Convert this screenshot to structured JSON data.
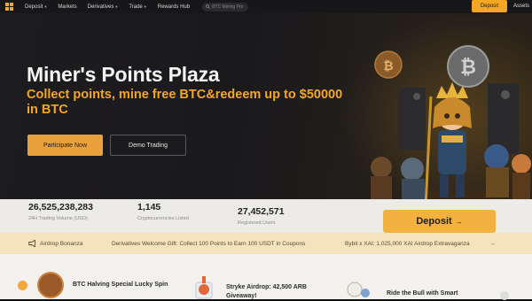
{
  "topbar": {
    "nav": [
      {
        "label": "Deposit",
        "caret": true
      },
      {
        "label": "Markets",
        "caret": false
      },
      {
        "label": "Derivatives",
        "caret": true
      },
      {
        "label": "Trade",
        "caret": true
      },
      {
        "label": "Rewards Hub",
        "caret": false
      }
    ],
    "search_placeholder": "BTC Mining Pro",
    "deposit_label": "Deposit",
    "assets_label": "Assets"
  },
  "hero": {
    "title": "Miner's Points Plaza",
    "subtitle": "Collect points, mine free BTC&redeem up to $50000 in BTC",
    "primary_button": "Participate Now",
    "secondary_button": "Demo Trading"
  },
  "stats": {
    "items": [
      {
        "value": "26,525,238,283",
        "label": "24H Trading Volume (USD)"
      },
      {
        "value": "1,145",
        "label": "Cryptocurrencies Listed"
      },
      {
        "value": "27,452,571",
        "label": "Registered Users"
      }
    ],
    "deposit_button": "Deposit",
    "deposit_arrow": "→"
  },
  "ticker": {
    "label": "Airdrop Bonanza",
    "items": [
      "Derivatives Welcome Gift: Collect 100 Points to Earn 100 USDT in Coupons",
      "Bybit x XAI: 1,025,000 XAI Airdrop Extravaganza"
    ],
    "arrow": "→"
  },
  "promos": [
    {
      "title": "BTC Halving Special Lucky Spin"
    },
    {
      "title": "Stryke Airdrop: 42,500 ARB Giveaway!"
    },
    {
      "title": "Ride the Bull with Smart"
    }
  ],
  "colors": {
    "accent": "#f5a623",
    "ticker_bg": "#f4e3bd",
    "stats_bg": "#ecebe8"
  }
}
